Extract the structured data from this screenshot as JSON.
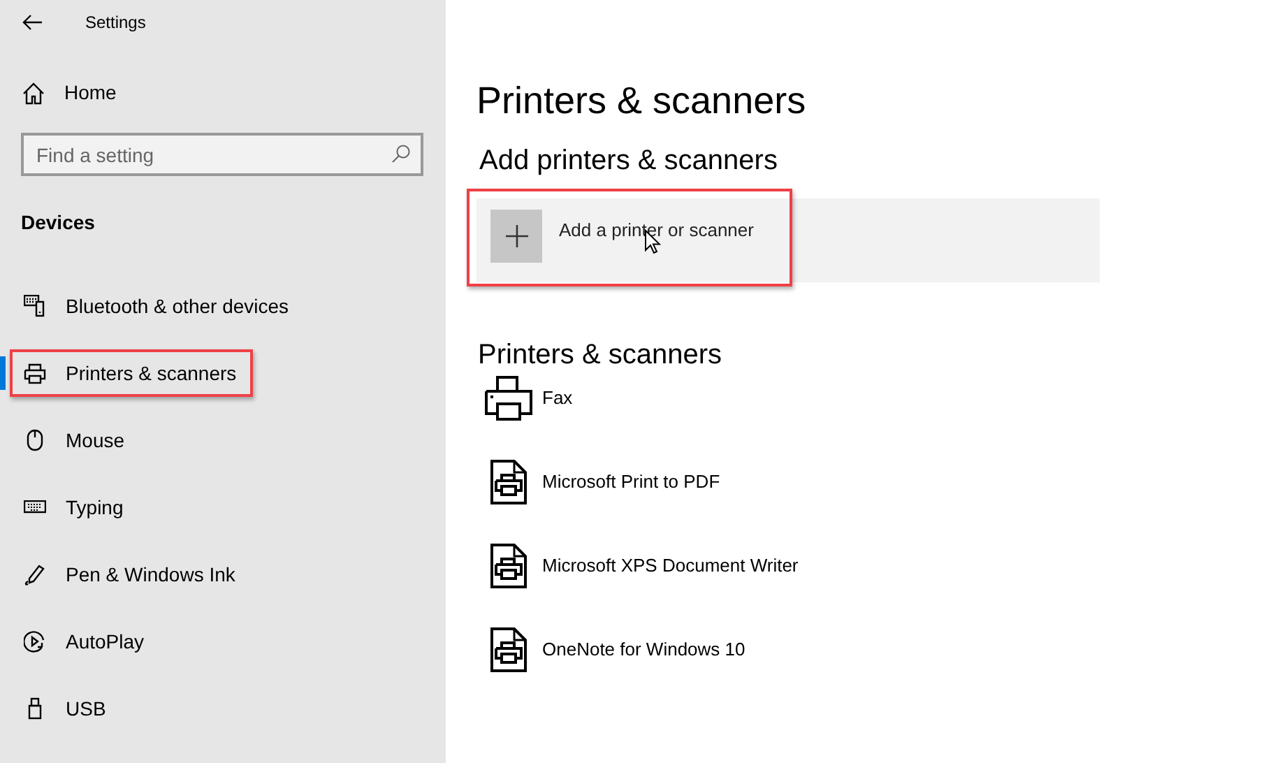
{
  "window": {
    "title": "Settings"
  },
  "home": {
    "label": "Home"
  },
  "search": {
    "placeholder": "Find a setting"
  },
  "section": "Devices",
  "nav": [
    {
      "label": "Bluetooth & other devices",
      "kind": "bluetooth",
      "selected": false,
      "highlighted": false
    },
    {
      "label": "Printers & scanners",
      "kind": "printer",
      "selected": true,
      "highlighted": true
    },
    {
      "label": "Mouse",
      "kind": "mouse",
      "selected": false,
      "highlighted": false
    },
    {
      "label": "Typing",
      "kind": "keyboard",
      "selected": false,
      "highlighted": false
    },
    {
      "label": "Pen & Windows Ink",
      "kind": "pen",
      "selected": false,
      "highlighted": false
    },
    {
      "label": "AutoPlay",
      "kind": "autoplay",
      "selected": false,
      "highlighted": false
    },
    {
      "label": "USB",
      "kind": "usb",
      "selected": false,
      "highlighted": false
    }
  ],
  "page_title": "Printers & scanners",
  "add_section": {
    "heading": "Add printers & scanners",
    "button": {
      "label": "Add a printer or scanner",
      "highlighted": true
    }
  },
  "list_section": {
    "heading": "Printers & scanners",
    "printers": [
      {
        "name": "Fax",
        "kind": "fax"
      },
      {
        "name": "Microsoft Print to PDF",
        "kind": "document"
      },
      {
        "name": "Microsoft XPS Document Writer",
        "kind": "document"
      },
      {
        "name": "OneNote for Windows 10",
        "kind": "document"
      }
    ]
  }
}
